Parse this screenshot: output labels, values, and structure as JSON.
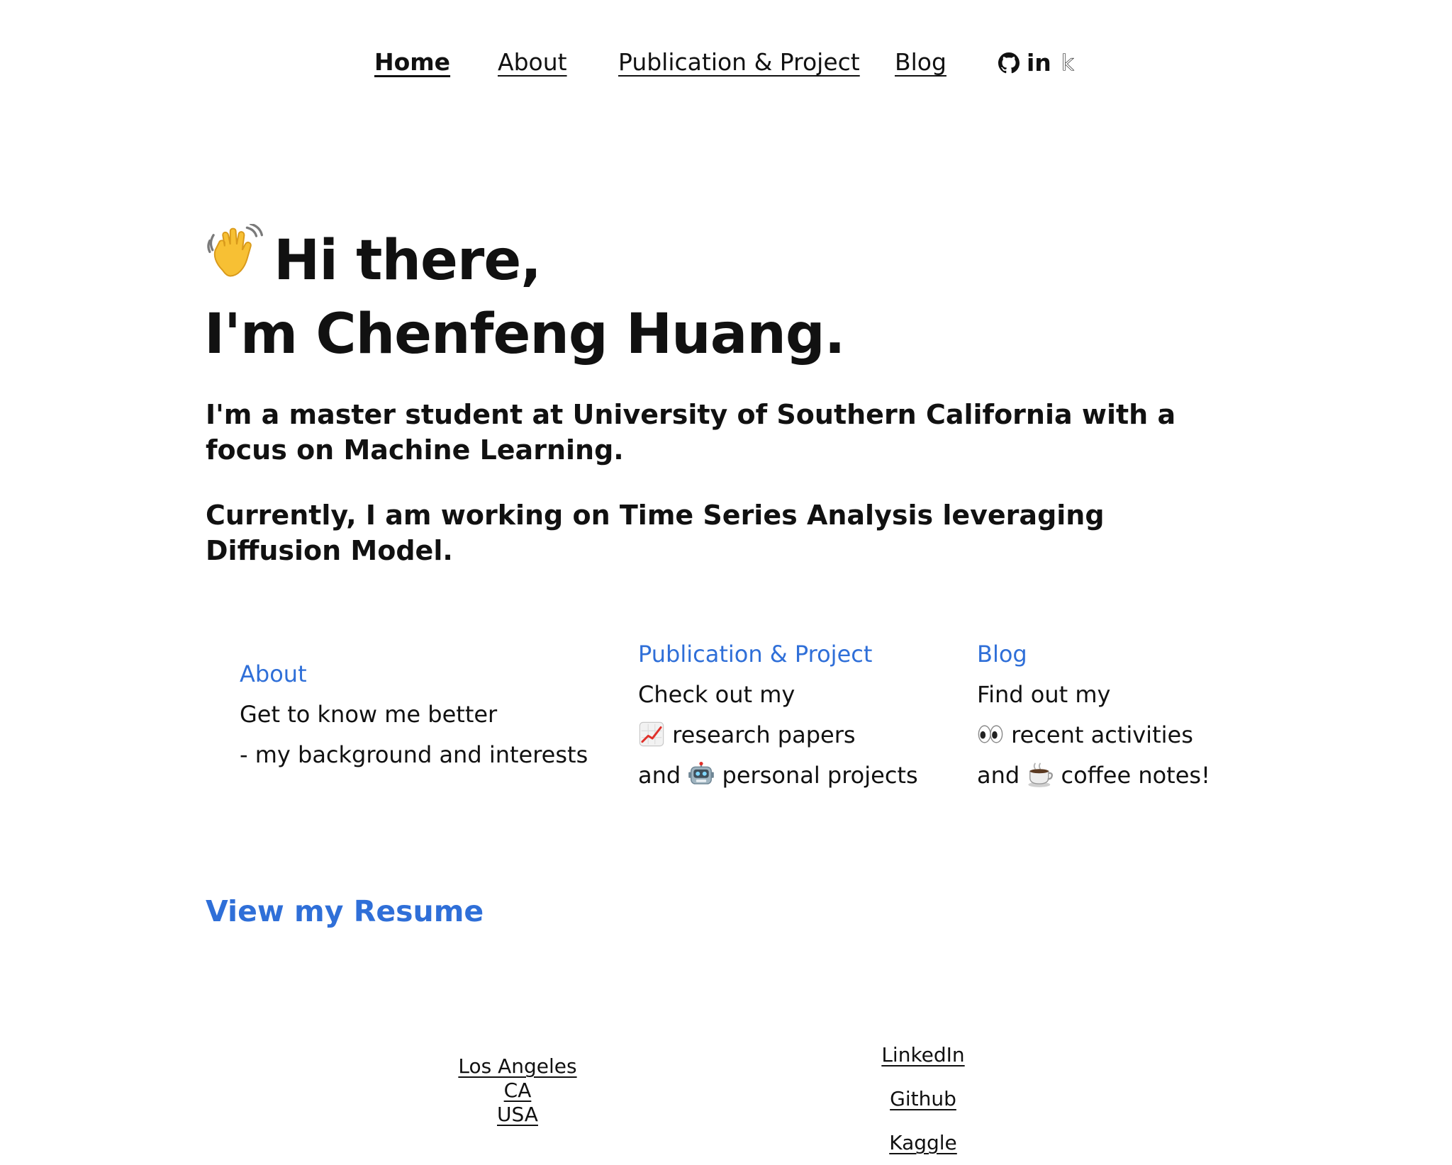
{
  "nav": {
    "items": [
      {
        "label": "Home",
        "active": true
      },
      {
        "label": "About"
      },
      {
        "label": "Publication & Project"
      },
      {
        "label": "Blog"
      }
    ],
    "social_icons": [
      "github-icon",
      "linkedin-icon",
      "kaggle-icon"
    ],
    "linkedin_glyph": "in",
    "kaggle_glyph": "k"
  },
  "hero": {
    "greeting_emoji": "waving-hand-icon",
    "line1": "Hi there,",
    "line2": "I'm Chenfeng Huang."
  },
  "intro": {
    "paragraph1": "I'm a master student at University of Southern California with a focus on Machine Learning.",
    "paragraph2": "Currently, I am working on Time Series Analysis leveraging Diffusion Model."
  },
  "cards": {
    "about": {
      "title": "About",
      "line1": "Get to know me better",
      "line2": "- my background and interests"
    },
    "publication": {
      "title": "Publication & Project",
      "line1": "Check out my",
      "line2": "research papers",
      "line3_prefix": "and",
      "line3": "personal projects",
      "icons": [
        "chart-increasing-icon",
        "robot-icon"
      ]
    },
    "blog": {
      "title": "Blog",
      "line1": "Find out my",
      "line2": "recent activities",
      "line3_prefix": "and",
      "line3": "coffee notes!",
      "icons": [
        "eyes-icon",
        "coffee-icon"
      ]
    }
  },
  "resume": {
    "label": "View my Resume"
  },
  "footer": {
    "location": [
      "Los Angeles",
      "CA",
      "USA"
    ],
    "links": [
      "LinkedIn",
      "Github",
      "Kaggle"
    ]
  },
  "colors": {
    "accent": "#2f6fd8",
    "text": "#111111",
    "background": "#ffffff"
  }
}
